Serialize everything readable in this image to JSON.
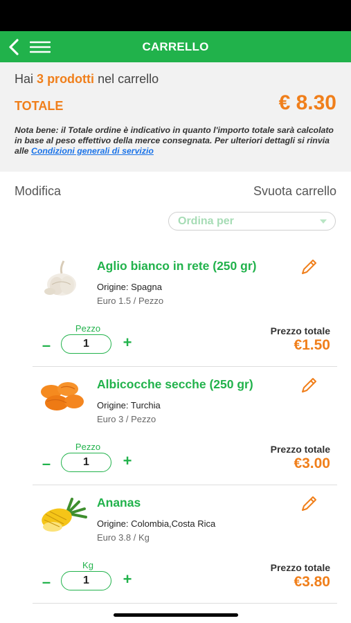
{
  "header": {
    "title": "CARRELLO"
  },
  "summary": {
    "prefix": "Hai",
    "count": "3",
    "count_label": "prodotti",
    "suffix": "nel carrello",
    "total_label": "TOTALE",
    "total_value": "€ 8.30",
    "note_text": "Nota bene: il Totale ordine è indicativo in quanto l'importo totale sarà calcolato in base al peso effettivo della merce consegnata. Per ulteriori dettagli si rinvia alle",
    "note_link": "Condizioni generali di servizio"
  },
  "actions": {
    "modifica": "Modifica",
    "svuota": "Svuota carrello"
  },
  "sort": {
    "placeholder": "Ordina per"
  },
  "items": [
    {
      "name": "Aglio bianco in rete (250 gr)",
      "origin": "Origine: Spagna",
      "unit_price": "Euro 1.5 / Pezzo",
      "unit_label": "Pezzo",
      "qty": "1",
      "total_label": "Prezzo totale",
      "total": "€1.50",
      "icon": "garlic-icon"
    },
    {
      "name": "Albicocche secche (250 gr)",
      "origin": "Origine: Turchia",
      "unit_price": "Euro 3 / Pezzo",
      "unit_label": "Pezzo",
      "qty": "1",
      "total_label": "Prezzo totale",
      "total": "€3.00",
      "icon": "dried-apricots-icon"
    },
    {
      "name": "Ananas",
      "origin": "Origine: Colombia,Costa Rica",
      "unit_price": "Euro 3.8 / Kg",
      "unit_label": "Kg",
      "qty": "1",
      "total_label": "Prezzo totale",
      "total": "€3.80",
      "icon": "pineapple-icon"
    }
  ],
  "controls": {
    "minus": "–",
    "plus": "+"
  },
  "colors": {
    "green": "#21b24b",
    "orange": "#f07f1b",
    "link": "#1a73e8"
  }
}
